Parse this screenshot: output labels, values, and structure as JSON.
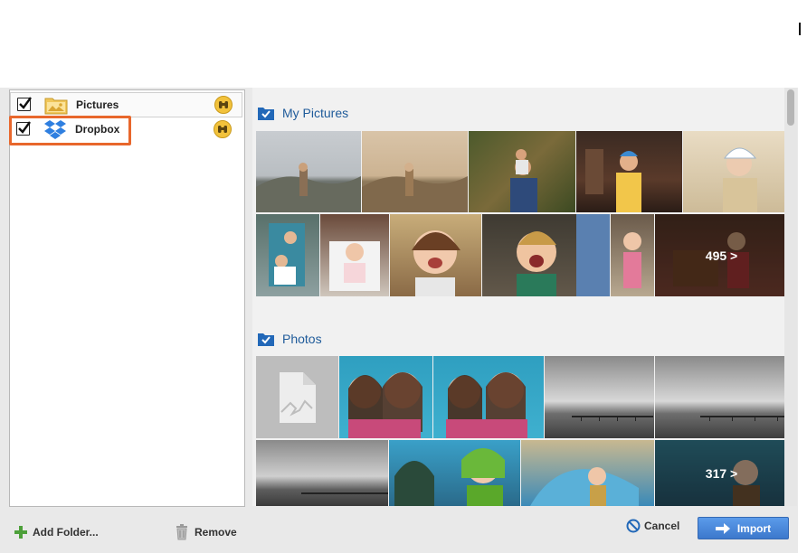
{
  "sources": [
    {
      "label": "Pictures",
      "checked": true,
      "icon": "pictures-folder-icon"
    },
    {
      "label": "Dropbox",
      "checked": true,
      "icon": "dropbox-icon"
    }
  ],
  "footer_left": {
    "add_folder_label": "Add Folder...",
    "remove_label": "Remove"
  },
  "groups": [
    {
      "title": "My Pictures",
      "more_count": "495 >"
    },
    {
      "title": "Photos",
      "more_count": "317 >"
    }
  ],
  "footer_right": {
    "cancel_label": "Cancel",
    "import_label": "Import"
  },
  "colors": {
    "accent_blue": "#1f5b9a",
    "highlight_orange": "#e8672c",
    "import_button": "#3c78cc",
    "dropbox_blue": "#2f7fe0",
    "find_button": "#f2c23c"
  }
}
